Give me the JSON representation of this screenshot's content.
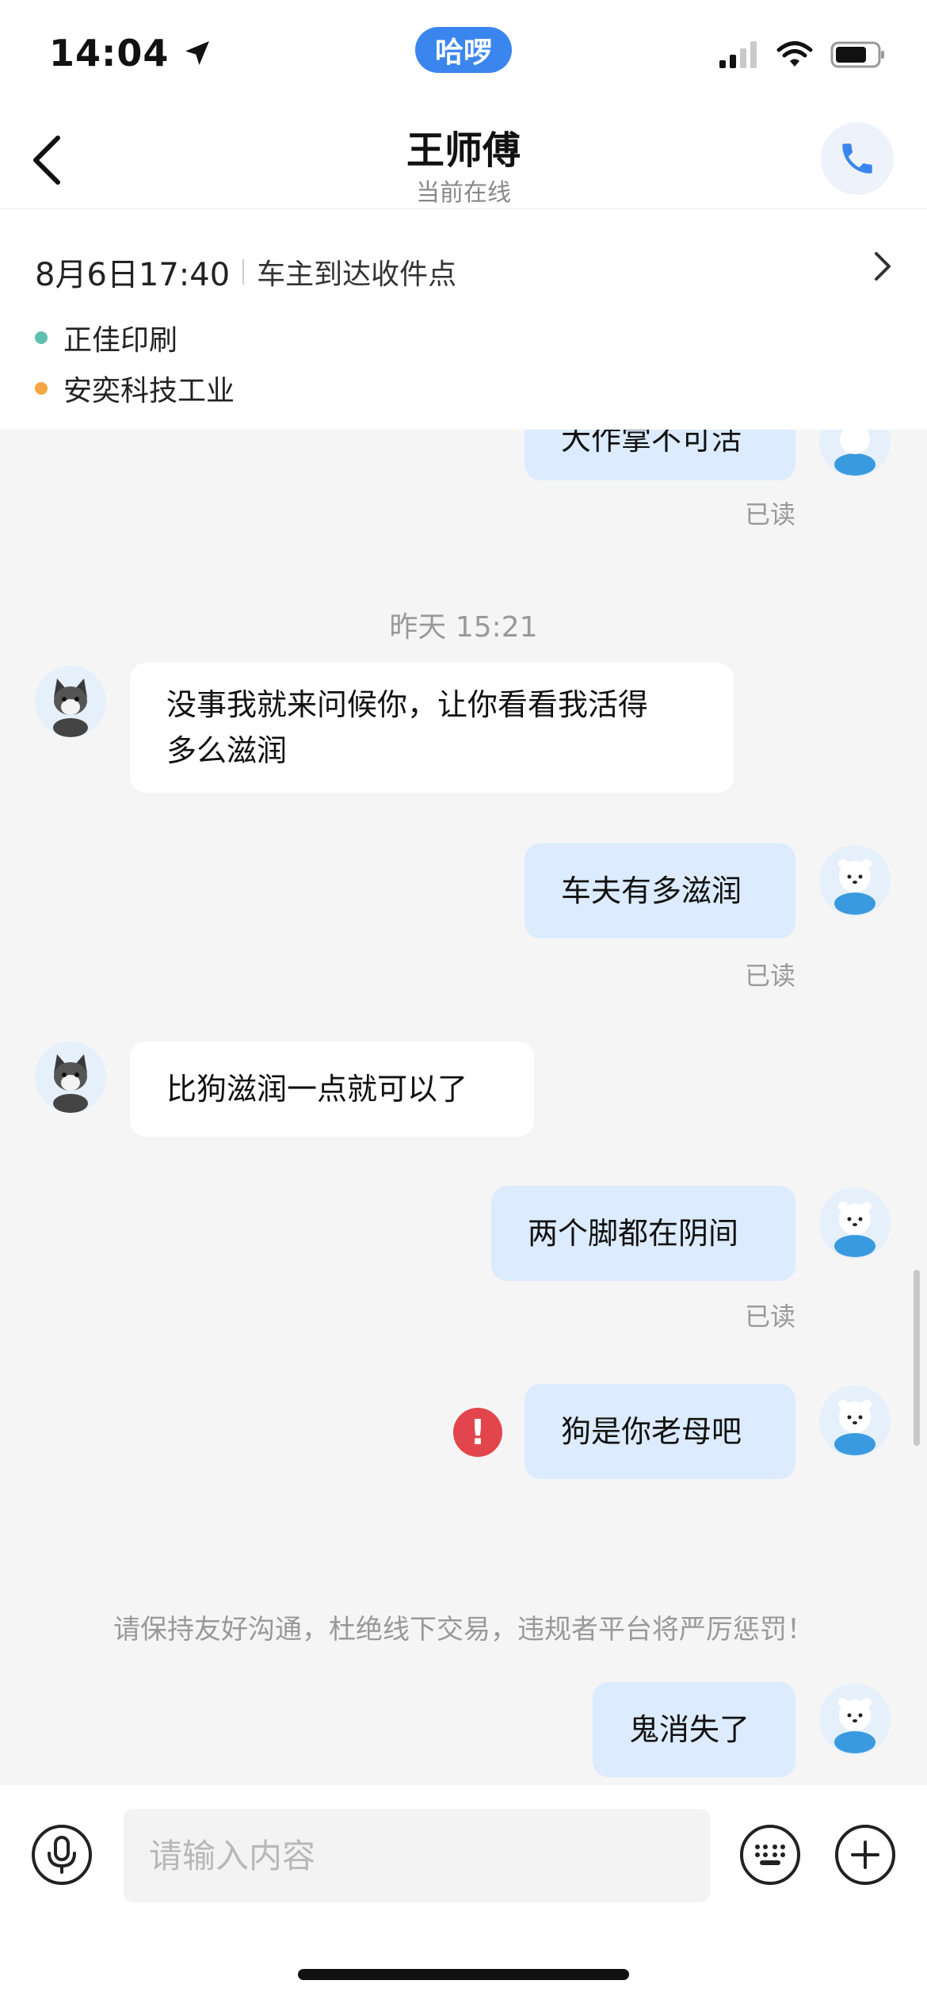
{
  "status_bar": {
    "time": "14:04",
    "pill_text": "哈啰"
  },
  "header": {
    "title": "王师傅",
    "subtitle": "当前在线"
  },
  "order": {
    "time": "8月6日17:40",
    "status": "车主到达收件点",
    "places": [
      {
        "name": "正佳印刷",
        "color": "#5fbfb0"
      },
      {
        "name": "安奕科技工业",
        "color": "#f5a742"
      }
    ]
  },
  "chat": {
    "partial_top_text": "大作掌不可活",
    "read_label": "已读",
    "time_separator": "昨天 15:21",
    "messages": [
      {
        "side": "in",
        "line1": "没事我就来问候你，让你看看我活得",
        "line2": "多么滋润"
      },
      {
        "side": "out",
        "text": "车夫有多滋润"
      },
      {
        "side": "in",
        "text": "比狗滋润一点就可以了"
      },
      {
        "side": "out",
        "text": "两个脚都在阴间"
      },
      {
        "side": "out",
        "text": "狗是你老母吧",
        "failed": true
      },
      {
        "side": "out",
        "text": "鬼消失了"
      }
    ],
    "notice": "请保持友好沟通，杜绝线下交易，违规者平台将严厉惩罚！"
  },
  "input": {
    "placeholder": "请输入内容"
  },
  "colors": {
    "accent": "#3a86ee",
    "bubble_out": "#dcebfd",
    "error": "#e2454b"
  },
  "icons": [
    "location-arrow-icon",
    "signal-icon",
    "wifi-icon",
    "battery-icon",
    "back-icon",
    "phone-icon",
    "chevron-right-icon",
    "voice-icon",
    "keyboard-icon",
    "plus-icon",
    "error-icon"
  ]
}
